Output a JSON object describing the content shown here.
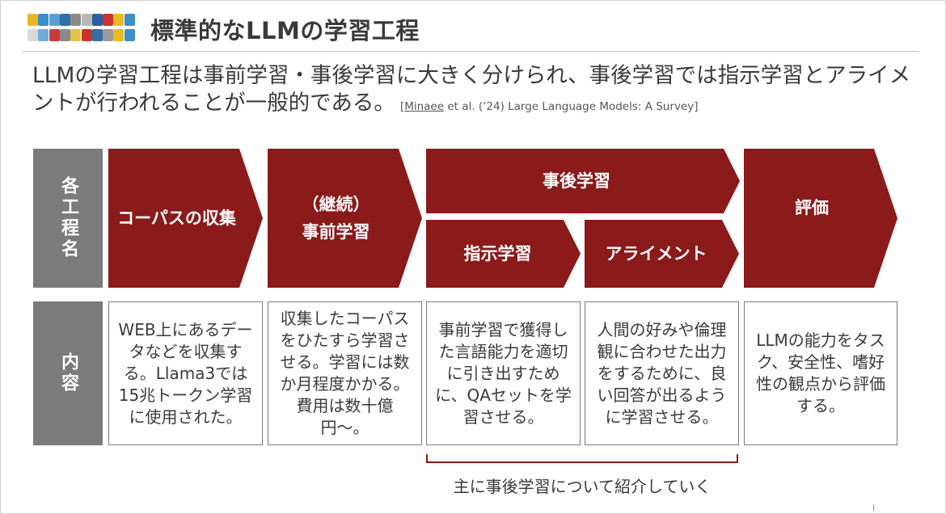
{
  "slide": {
    "title": "標準的なLLMの学習工程",
    "lead": "LLMの学習工程は事前学習・事後学習に大きく分けられ、事後学習では指示学習とアライメントが行われることが一般的である。",
    "reference_author": "Minaee",
    "reference_rest": " et al. (’24) Large Language Models: A Survey]",
    "reference_open": "[",
    "logo_colors": [
      "#e8b923",
      "#3a8fc7",
      "#5a9fd4",
      "#2f6ea8",
      "#8a8a8a",
      "#b8b8b8",
      "#2e5f9e",
      "#c8332e",
      "#e8b923",
      "#3a8fc7",
      "#d9d9d9",
      "#6fa8dc",
      "#cc3b3b",
      "#8a8a8a",
      "#e3c24a",
      "#c8332e",
      "#2f6ea8",
      "#9a9a9a",
      "#e8b923",
      "#3a8fc7"
    ]
  },
  "row_labels": {
    "process": "各工程名",
    "content": "内容"
  },
  "stages": {
    "corpus": "コーパスの収集",
    "pretrain": "（継続）\n事前学習",
    "posttrain": "事後学習",
    "instruction": "指示学習",
    "alignment": "アライメント",
    "evaluation": "評価"
  },
  "descriptions": {
    "corpus": "WEB上にあるデータなどを収集する。Llama3では15兆トークン学習に使用された。",
    "pretrain": "収集したコーパスをひたすら学習させる。学習には数か月程度かかる。費用は数十億円〜。",
    "instruction": "事前学習で獲得した言語能力を適切に引き出すために、QAセットを学習させる。",
    "alignment": "人間の好みや倫理観に合わせた出力をするために、良い回答が出るように学習させる。",
    "evaluation": "LLMの能力をタスク、安全性、嗜好性の観点から評価する。"
  },
  "focus_note": "主に事後学習について紹介していく",
  "colors": {
    "arrow": "#8b1a1a",
    "label_box": "#7b7b7b",
    "border": "#7b7b7b"
  }
}
